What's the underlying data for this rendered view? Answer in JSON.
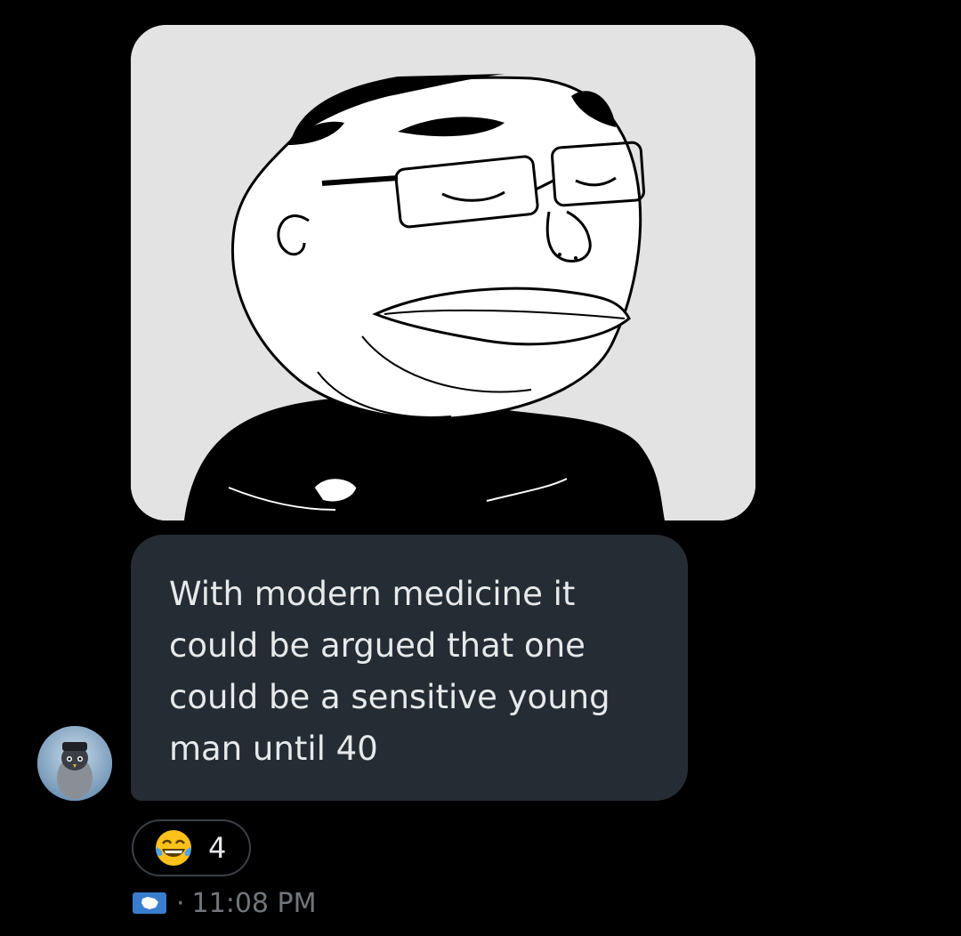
{
  "message": {
    "text": "With modern medicine it\ncould be argued that one\ncould be a sensitive young\nman until 40",
    "bubble_color": "#252c33"
  },
  "image": {
    "icon": "meme-drawing-image",
    "background": "#e3e3e3"
  },
  "sender": {
    "avatar_icon": "penguin-avatar-icon"
  },
  "reaction": {
    "emoji_icon": "tears-of-joy-emoji-icon",
    "count": "4"
  },
  "meta": {
    "flag_icon": "antarctica-flag-icon",
    "separator": "·",
    "time": "11:08 PM"
  }
}
